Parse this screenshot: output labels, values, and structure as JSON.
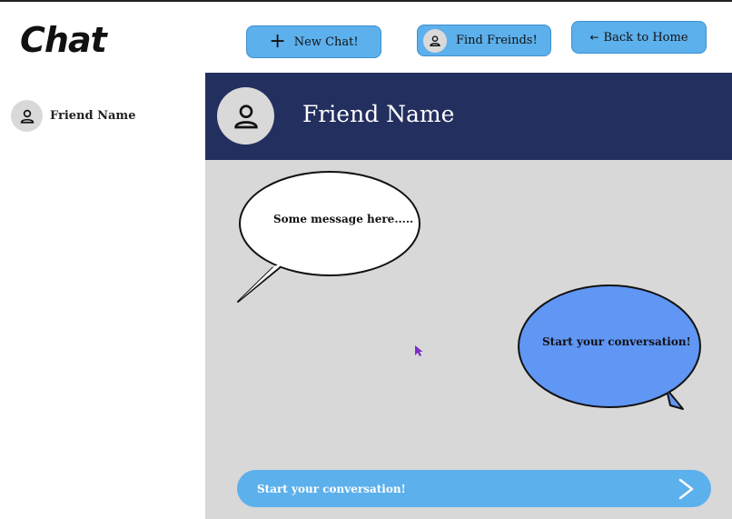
{
  "app": {
    "title": "Chat"
  },
  "toolbar": {
    "new_chat_label": "New Chat!",
    "find_friends_label": "Find Freinds!",
    "back_home_label": "Back to Home",
    "new_chat_icon": "+",
    "back_icon": "←"
  },
  "sidebar": {
    "items": [
      {
        "name": "Friend Name",
        "icon": "person-icon"
      }
    ]
  },
  "chat": {
    "header_name": "Friend Name",
    "messages": [
      {
        "direction": "incoming",
        "text": "Some message here....."
      },
      {
        "direction": "outgoing",
        "text": "Start your conversation!"
      }
    ],
    "input_placeholder": "Start your conversation!"
  },
  "colors": {
    "button": "#5cb0ec",
    "header": "#232f5e",
    "chat_background": "#d8d8d8",
    "outgoing_bubble": "#6096f4",
    "incoming_bubble": "#ffffff"
  }
}
